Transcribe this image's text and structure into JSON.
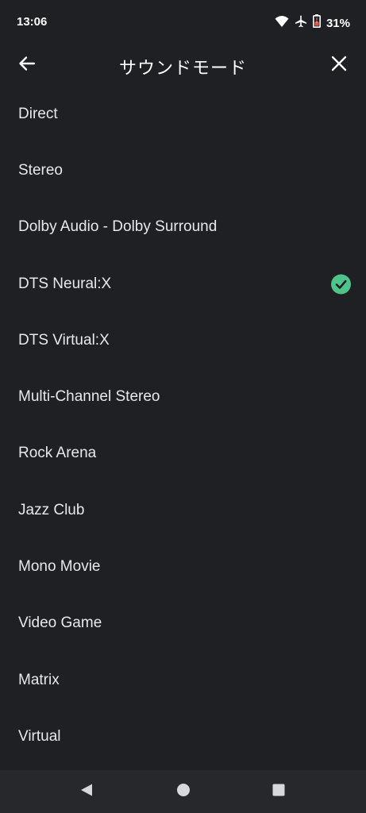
{
  "status_bar": {
    "time": "13:06",
    "battery_percent": "31%",
    "icons": [
      "wifi-icon",
      "airplane-mode-icon",
      "battery-low-icon"
    ]
  },
  "header": {
    "title": "サウンドモード",
    "back_icon": "arrow-left-icon",
    "close_icon": "close-icon"
  },
  "sound_modes": [
    {
      "label": "Direct",
      "selected": false
    },
    {
      "label": "Stereo",
      "selected": false
    },
    {
      "label": "Dolby Audio - Dolby Surround",
      "selected": false
    },
    {
      "label": "DTS Neural:X",
      "selected": true
    },
    {
      "label": "DTS Virtual:X",
      "selected": false
    },
    {
      "label": "Multi-Channel Stereo",
      "selected": false
    },
    {
      "label": "Rock Arena",
      "selected": false
    },
    {
      "label": "Jazz Club",
      "selected": false
    },
    {
      "label": "Mono Movie",
      "selected": false
    },
    {
      "label": "Video Game",
      "selected": false
    },
    {
      "label": "Matrix",
      "selected": false
    },
    {
      "label": "Virtual",
      "selected": false
    }
  ],
  "colors": {
    "background": "#1f2024",
    "nav_bar": "#27282c",
    "check_accent": "#4fc38a",
    "battery_warning": "#e0563f"
  },
  "nav_bar": {
    "buttons": [
      "back-triangle-icon",
      "home-circle-icon",
      "recents-square-icon"
    ]
  }
}
